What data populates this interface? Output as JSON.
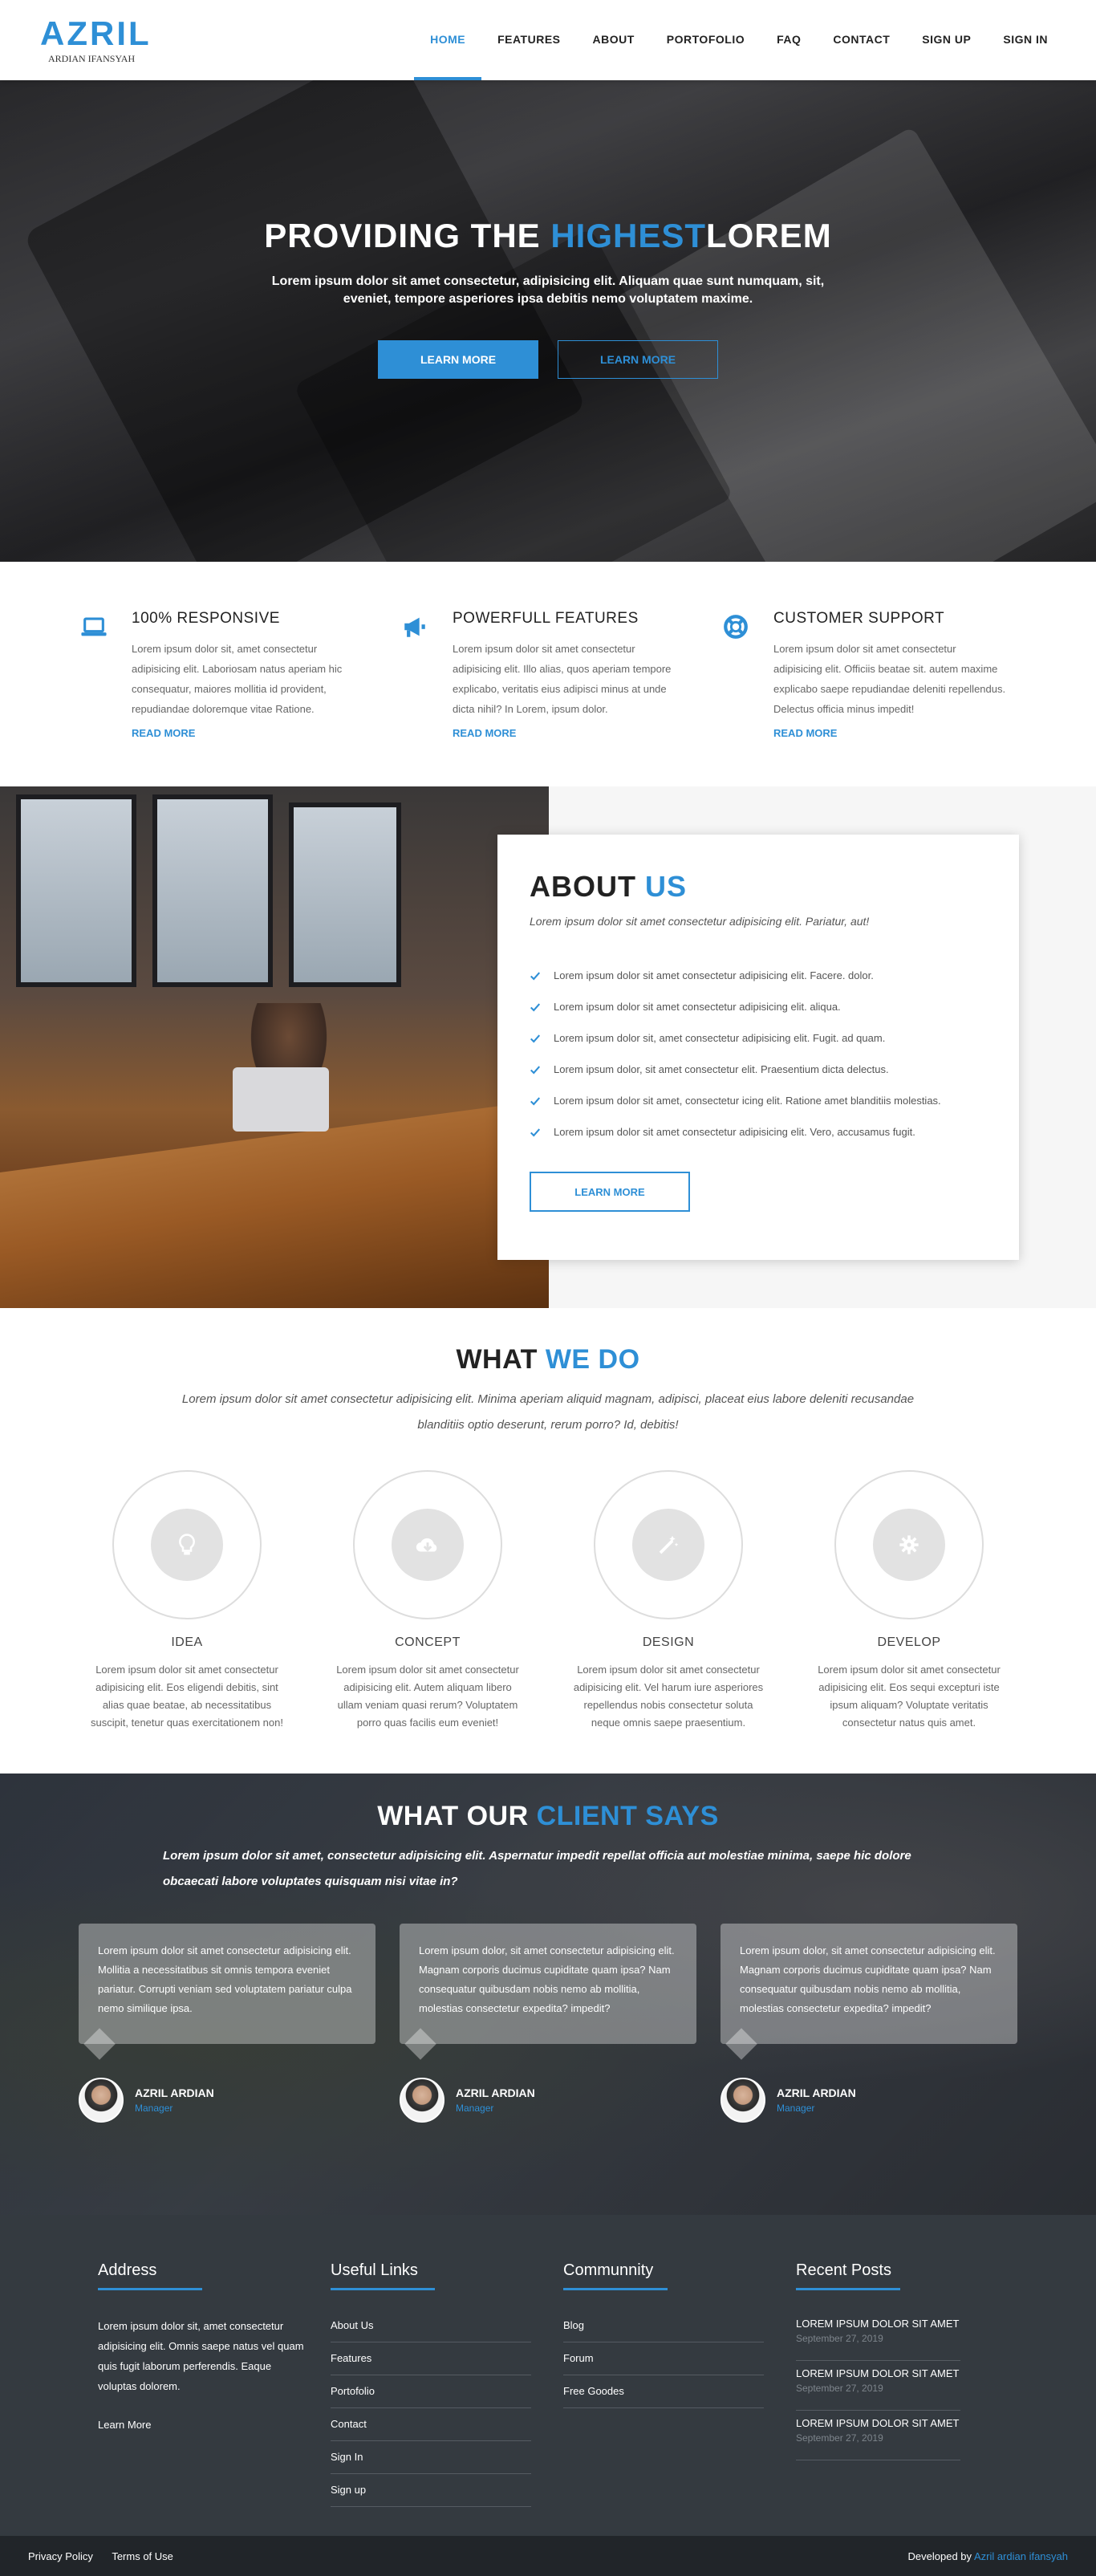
{
  "brand": {
    "name": "AZRIL",
    "sub": "ARDIAN IFANSYAH",
    "accent": "#2e8fd6"
  },
  "nav": [
    "HOME",
    "FEATURES",
    "ABOUT",
    "PORTOFOLIO",
    "FAQ",
    "CONTACT",
    "SIGN UP",
    "SIGN IN"
  ],
  "hero": {
    "title_pre": "PROVIDING THE ",
    "title_hl": "HIGHEST",
    "title_post": "LOREM",
    "text": "Lorem ipsum dolor sit amet consectetur, adipisicing elit. Aliquam quae sunt numquam, sit, eveniet, tempore asperiores ipsa debitis nemo voluptatem maxime.",
    "primary_btn": "LEARN MORE",
    "secondary_btn": "LEARN MORE"
  },
  "features": [
    {
      "icon": "laptop-icon",
      "title": "100% RESPONSIVE",
      "text": "Lorem ipsum dolor sit, amet consectetur adipisicing elit. Laboriosam natus aperiam hic consequatur, maiores mollitia id provident, repudiandae doloremque vitae Ratione.",
      "link": "READ MORE"
    },
    {
      "icon": "megaphone-icon",
      "title": "POWERFULL FEATURES",
      "text": "Lorem ipsum dolor sit amet consectetur adipisicing elit. Illo alias, quos aperiam tempore explicabo, veritatis eius adipisci minus at unde dicta nihil? In Lorem, ipsum dolor.",
      "link": "READ MORE"
    },
    {
      "icon": "lifebuoy-icon",
      "title": "CUSTOMER SUPPORT",
      "text": "Lorem ipsum dolor sit amet consectetur adipisicing elit. Officiis beatae sit. autem maxime explicabo saepe repudiandae deleniti repellendus. Delectus officia minus impedit!",
      "link": "READ MORE"
    }
  ],
  "about": {
    "title_pre": "ABOUT ",
    "title_hl": "US",
    "subtitle": "Lorem ipsum dolor sit amet consectetur adipisicing elit. Pariatur, aut!",
    "items": [
      "Lorem ipsum dolor sit amet consectetur adipisicing elit. Facere. dolor.",
      "Lorem ipsum dolor sit amet consectetur adipisicing elit. aliqua.",
      "Lorem ipsum dolor sit, amet consectetur adipisicing elit. Fugit. ad quam.",
      "Lorem ipsum dolor, sit amet consectetur elit. Praesentium dicta delectus.",
      "Lorem ipsum dolor sit amet, consectetur icing elit. Ratione amet blanditiis molestias.",
      "Lorem ipsum dolor sit amet consectetur adipisicing elit. Vero, accusamus fugit."
    ],
    "button": "LEARN MORE"
  },
  "whatwedo": {
    "title_pre": "WHAT ",
    "title_hl": "WE DO",
    "subtitle": "Lorem ipsum dolor sit amet consectetur adipisicing elit. Minima aperiam aliquid magnam, adipisci, placeat eius labore deleniti recusandae blanditiis optio deserunt, rerum porro? Id, debitis!",
    "services": [
      {
        "icon": "lightbulb-icon",
        "name": "IDEA",
        "text": "Lorem ipsum dolor sit amet consectetur adipisicing elit. Eos eligendi debitis, sint alias quae beatae, ab necessitatibus suscipit, tenetur quas exercitationem non!"
      },
      {
        "icon": "cloud-download-icon",
        "name": "CONCEPT",
        "text": "Lorem ipsum dolor sit amet consectetur adipisicing elit. Autem aliquam libero ullam veniam quasi rerum? Voluptatem porro quas facilis eum eveniet!"
      },
      {
        "icon": "magic-wand-icon",
        "name": "DESIGN",
        "text": "Lorem ipsum dolor sit amet consectetur adipisicing elit. Vel harum iure asperiores repellendus nobis consectetur soluta neque omnis saepe praesentium."
      },
      {
        "icon": "gear-icon",
        "name": "DEVELOP",
        "text": "Lorem ipsum dolor sit amet consectetur adipisicing elit. Eos sequi excepturi iste ipsum aliquam? Voluptate veritatis consectetur natus quis amet."
      }
    ]
  },
  "testimonials": {
    "title_pre": "WHAT OUR ",
    "title_hl": "CLIENT SAYS",
    "subtitle": "Lorem ipsum dolor sit amet, consectetur adipisicing elit. Aspernatur impedit repellat officia aut molestiae minima, saepe hic dolore obcaecati labore voluptates quisquam nisi vitae in?",
    "items": [
      {
        "text": "Lorem ipsum dolor sit amet consectetur adipisicing elit. Mollitia a necessitatibus sit omnis tempora eveniet pariatur. Corrupti veniam sed voluptatem pariatur culpa nemo similique ipsa.",
        "name": "AZRIL ARDIAN",
        "role": "Manager"
      },
      {
        "text": "Lorem ipsum dolor, sit amet consectetur adipisicing elit. Magnam corporis ducimus cupiditate quam ipsa? Nam consequatur quibusdam nobis nemo ab mollitia, molestias consectetur expedita? impedit?",
        "name": "AZRIL ARDIAN",
        "role": "Manager"
      },
      {
        "text": "Lorem ipsum dolor, sit amet consectetur adipisicing elit. Magnam corporis ducimus cupiditate quam ipsa? Nam consequatur quibusdam nobis nemo ab mollitia, molestias consectetur expedita? impedit?",
        "name": "AZRIL ARDIAN",
        "role": "Manager"
      }
    ]
  },
  "footer": {
    "address": {
      "title": "Address",
      "text": "Lorem ipsum dolor sit, amet consectetur adipisicing elit. Omnis saepe natus vel quam quis fugit laborum perferendis. Eaque voluptas dolorem.",
      "link": "Learn More"
    },
    "useful": {
      "title": "Useful Links",
      "links": [
        "About Us",
        "Features",
        "Portofolio",
        "Contact",
        "Sign In",
        "Sign up"
      ]
    },
    "community": {
      "title": "Communnity",
      "links": [
        "Blog",
        "Forum",
        "Free Goodes"
      ]
    },
    "recent": {
      "title": "Recent Posts",
      "posts": [
        {
          "title": "LOREM IPSUM DOLOR SIT AMET",
          "date": "September 27, 2019"
        },
        {
          "title": "LOREM IPSUM DOLOR SIT AMET",
          "date": "September 27, 2019"
        },
        {
          "title": "LOREM IPSUM DOLOR SIT AMET",
          "date": "September 27, 2019"
        }
      ]
    }
  },
  "bottombar": {
    "privacy": "Privacy Policy",
    "terms": "Terms of Use",
    "dev_label": "Developed by ",
    "dev_name": "Azril ardian ifansyah"
  }
}
